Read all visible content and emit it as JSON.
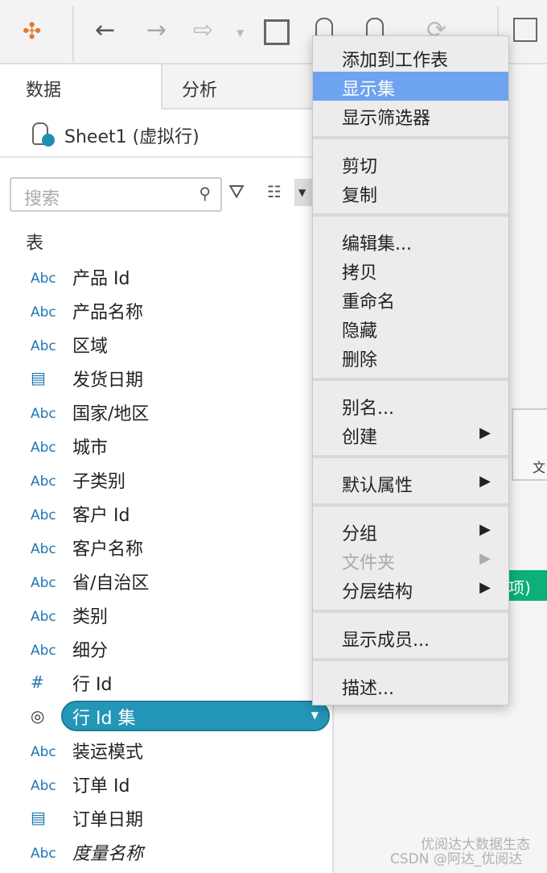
{
  "toolbar": {
    "icons": [
      "tableau-logo-icon",
      "back-icon",
      "forward-icon",
      "redo-icon",
      "save-icon",
      "datasource-icon",
      "datasource-dropdown-icon",
      "refresh-icon",
      "new-worksheet-icon"
    ]
  },
  "tabs": [
    {
      "label": "数据"
    },
    {
      "label": "分析"
    }
  ],
  "datasource": {
    "label": "Sheet1 (虚拟行)"
  },
  "search": {
    "placeholder": "搜索"
  },
  "section_label": "表",
  "fields": [
    {
      "type": "Abc",
      "name": "产品 Id"
    },
    {
      "type": "Abc",
      "name": "产品名称"
    },
    {
      "type": "Abc",
      "name": "区域"
    },
    {
      "type": "date",
      "name": "发货日期"
    },
    {
      "type": "Abc",
      "name": "国家/地区"
    },
    {
      "type": "Abc",
      "name": "城市"
    },
    {
      "type": "Abc",
      "name": "子类别"
    },
    {
      "type": "Abc",
      "name": "客户 Id"
    },
    {
      "type": "Abc",
      "name": "客户名称"
    },
    {
      "type": "Abc",
      "name": "省/自治区"
    },
    {
      "type": "Abc",
      "name": "类别"
    },
    {
      "type": "Abc",
      "name": "细分"
    },
    {
      "type": "#",
      "name": "行 Id"
    },
    {
      "type": "set",
      "name": "行 Id 集",
      "selected": true
    },
    {
      "type": "Abc",
      "name": "装运模式"
    },
    {
      "type": "Abc",
      "name": "订单 Id"
    },
    {
      "type": "date",
      "name": "订单日期"
    },
    {
      "type": "Abc",
      "name": "度量名称",
      "italic": true
    }
  ],
  "menu": {
    "groups": [
      [
        {
          "label": "添加到工作表"
        },
        {
          "label": "显示集",
          "highlighted": true
        },
        {
          "label": "显示筛选器"
        }
      ],
      [
        {
          "label": "剪切"
        },
        {
          "label": "复制"
        }
      ],
      [
        {
          "label": "编辑集..."
        },
        {
          "label": "拷贝"
        },
        {
          "label": "重命名"
        },
        {
          "label": "隐藏"
        },
        {
          "label": "删除"
        }
      ],
      [
        {
          "label": "别名..."
        },
        {
          "label": "创建",
          "submenu": true
        }
      ],
      [
        {
          "label": "默认属性",
          "submenu": true
        }
      ],
      [
        {
          "label": "分组",
          "submenu": true
        },
        {
          "label": "文件夹",
          "submenu": true,
          "disabled": true
        },
        {
          "label": "分层结构",
          "submenu": true
        }
      ],
      [
        {
          "label": "显示成员..."
        }
      ],
      [
        {
          "label": "描述..."
        }
      ]
    ]
  },
  "right": {
    "partial_card_label": "文",
    "partial_green_label": "项)",
    "green": "#0bb07a"
  },
  "watermark": {
    "line1": "优阅达大数据生态",
    "line2": "CSDN @阿达_优阅达"
  },
  "colors": {
    "highlight": "#6ea3f0",
    "set_pill": "#2496b8",
    "field_icon": "#1f77b4"
  }
}
